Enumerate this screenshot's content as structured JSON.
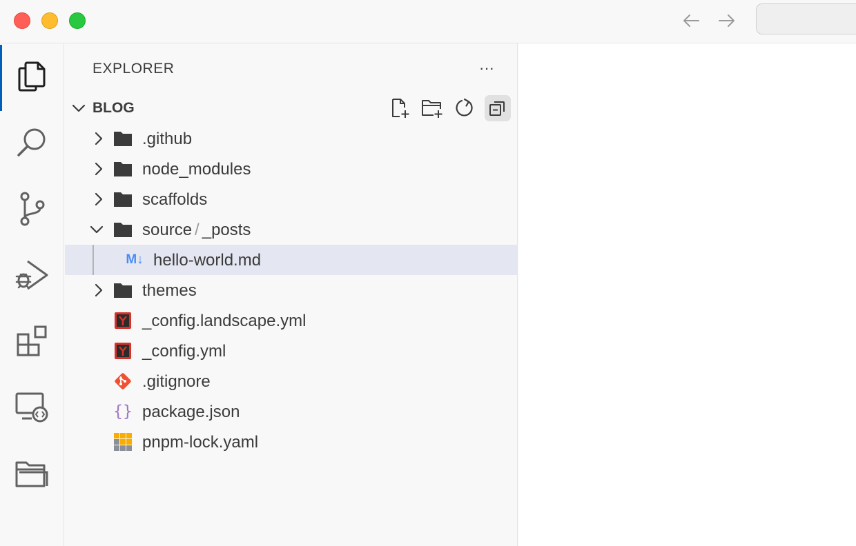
{
  "window": {
    "controls": [
      "close",
      "minimize",
      "maximize"
    ],
    "nav": {
      "back_icon": "arrow-left-icon",
      "forward_icon": "arrow-right-icon"
    }
  },
  "activity_bar": {
    "active": "explorer",
    "items": [
      {
        "id": "explorer",
        "icon": "files-icon"
      },
      {
        "id": "search",
        "icon": "search-icon"
      },
      {
        "id": "source-control",
        "icon": "source-control-icon"
      },
      {
        "id": "run-debug",
        "icon": "run-debug-icon"
      },
      {
        "id": "extensions",
        "icon": "extensions-icon"
      },
      {
        "id": "remote-explorer",
        "icon": "remote-explorer-icon"
      },
      {
        "id": "folders",
        "icon": "folder-icon"
      }
    ]
  },
  "explorer": {
    "title": "EXPLORER",
    "more": "···",
    "section": {
      "name": "BLOG",
      "actions": [
        {
          "id": "new-file",
          "icon": "new-file-icon"
        },
        {
          "id": "new-folder",
          "icon": "new-folder-icon"
        },
        {
          "id": "refresh",
          "icon": "refresh-icon"
        },
        {
          "id": "collapse-all",
          "icon": "collapse-all-icon",
          "pressed": true
        }
      ]
    },
    "tree": {
      "github": ".github",
      "node_modules": "node_modules",
      "scaffolds": "scaffolds",
      "source_a": "source",
      "source_sep": "/",
      "source_b": "_posts",
      "hello_world": "hello-world.md",
      "hello_world_badge": "M↓",
      "themes": "themes",
      "config_landscape": "_config.landscape.yml",
      "config": "_config.yml",
      "gitignore": ".gitignore",
      "package_json": "package.json",
      "pnpm_lock": "pnpm-lock.yaml",
      "json_glyph": "{}"
    }
  },
  "colors": {
    "accent": "#005fb8",
    "selection": "#e4e6f1",
    "folder": "#3b3b3b",
    "yaml_red": "#d9312a",
    "git_orange": "#f05133",
    "json_purple": "#a074c4",
    "markdown_blue": "#4a8cf7"
  }
}
